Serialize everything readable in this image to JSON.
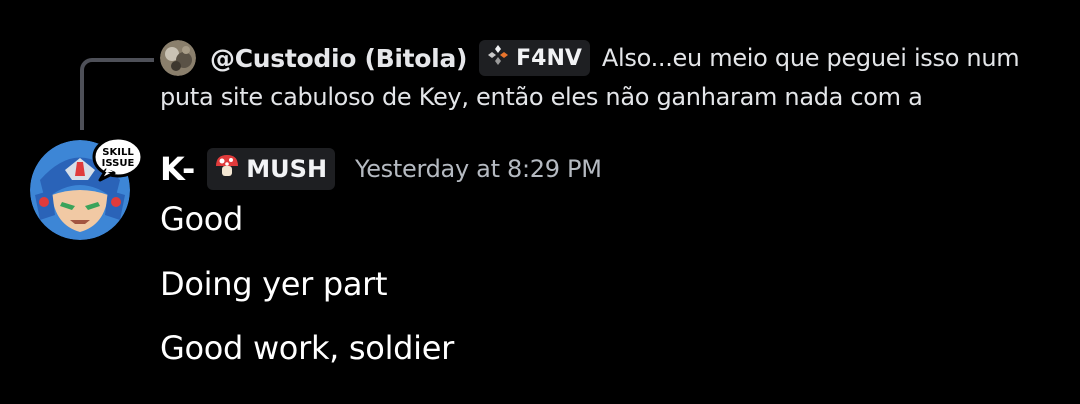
{
  "reply": {
    "author": "@Custodio (Bitola)",
    "tag": "F4NV",
    "tag_icon": "four-diamond-icon",
    "preview_line1": "Also...eu meio que peguei isso num",
    "preview_line2": "puta site cabuloso de Key, então eles não ganharam nada com a"
  },
  "message": {
    "username": "K-",
    "tag": "MUSH",
    "tag_icon": "mushroom-icon",
    "timestamp": "Yesterday at 8:29 PM",
    "avatar_badge_lines": [
      "SKILL",
      "ISSUE"
    ],
    "lines": [
      "Good",
      "Doing yer part",
      "Good work, soldier"
    ]
  },
  "colors": {
    "background": "#000000",
    "reply_spine": "#4e5058",
    "tag_background": "#1e1f22",
    "timestamp": "#b5bac1",
    "text": "#ffffff",
    "mushroom_red": "#e03b3b"
  }
}
